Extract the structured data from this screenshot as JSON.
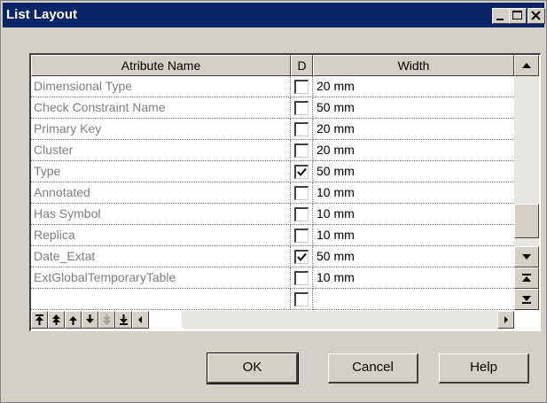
{
  "window": {
    "title": "List Layout"
  },
  "titlebar_buttons": [
    "minimize-icon",
    "maximize-icon",
    "close-icon"
  ],
  "columns": {
    "name": "Atribute Name",
    "d": "D",
    "width": "Width"
  },
  "rows": [
    {
      "name": "Dimensional Type",
      "checked": false,
      "width": "20 mm"
    },
    {
      "name": "Check Constraint Name",
      "checked": false,
      "width": "50 mm"
    },
    {
      "name": "Primary Key",
      "checked": false,
      "width": "20 mm"
    },
    {
      "name": "Cluster",
      "checked": false,
      "width": "20 mm"
    },
    {
      "name": "Type",
      "checked": true,
      "width": "50 mm"
    },
    {
      "name": "Annotated",
      "checked": false,
      "width": "10 mm"
    },
    {
      "name": "Has Symbol",
      "checked": false,
      "width": "10 mm"
    },
    {
      "name": "Replica",
      "checked": false,
      "width": "10 mm"
    },
    {
      "name": "Date_Extat",
      "checked": true,
      "width": "50 mm"
    },
    {
      "name": "ExtGlobalTemporaryTable",
      "checked": false,
      "width": "10 mm"
    },
    {
      "name": "",
      "checked": false,
      "width": ""
    }
  ],
  "toolbar_icons": [
    "move-to-top-icon",
    "move-up-page-icon",
    "move-up-icon",
    "move-down-icon",
    "move-down-page-icon",
    "move-to-bottom-icon"
  ],
  "buttons": {
    "ok": "OK",
    "cancel": "Cancel",
    "help": "Help"
  },
  "colors": {
    "titlebar": "#0a246a",
    "face": "#d4d0c8",
    "disabled_text": "#808080"
  }
}
